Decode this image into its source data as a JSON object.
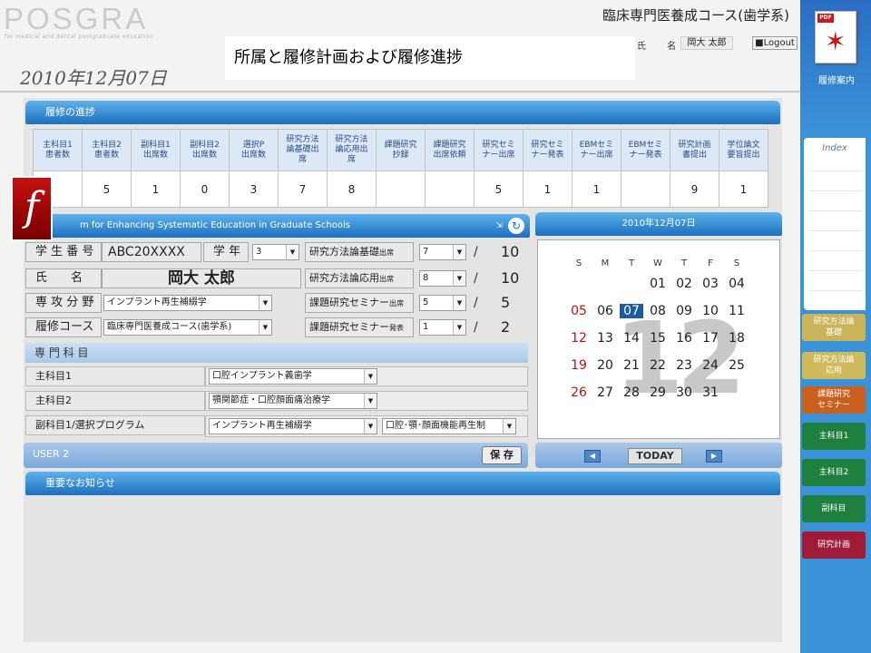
{
  "header": {
    "logo": "POSGRA",
    "logo_sub": "for medical and dental postgraduate education",
    "course": "臨床専門医養成コース(歯学系)",
    "name_label": "氏 名",
    "name_value": "岡大 太郎",
    "logout_label": "■Logout",
    "date": "2010年12月07日"
  },
  "popup": {
    "title": "所属と履修計画および履修進捗"
  },
  "progress": {
    "title": "履修の進捗",
    "headers": [
      "主科目1患者数",
      "主科目2患者数",
      "副科目1出席数",
      "副科目2出席数",
      "選択P出席数",
      "研究方法論基礎出席",
      "研究方法論応用出席",
      "課題研究抄録",
      "課題研究出席依頼",
      "研究セミナー出席",
      "研究セミナー発表",
      "EBMセミナー出席",
      "EBMセミナー発表",
      "研究計画書提出",
      "学位論文要旨提出"
    ],
    "headers_html": [
      "主科目1<br>患者数",
      "主科目2<br>患者数",
      "副科目1<br>出席数",
      "副科目2<br>出席数",
      "選択P<br>出席数",
      "研究方法<br>論基礎出<br>席",
      "研究方法<br>論応用出<br>席",
      "課題研究<br>抄録",
      "課題研究<br>出席依頼",
      "研究セミ<br>ナー出席",
      "研究セミ<br>ナー発表",
      "EBMセミ<br>ナー出席",
      "EBMセミ<br>ナー発表",
      "研究計画<br>書提出",
      "学位論文<br>要旨提出"
    ],
    "values": [
      "",
      "5",
      "1",
      "0",
      "3",
      "7",
      "8",
      "",
      "",
      "5",
      "1",
      "1",
      "",
      "9",
      "1"
    ]
  },
  "form": {
    "bar_title": "m for Enhancing Systematic Education in Graduate Schools",
    "student_no_label": "学 生 番 号",
    "student_no": "ABC20XXXX",
    "year_label": "学 年",
    "year_value": "3",
    "name_label": "氏　　名",
    "name_value": "岡大 太郎",
    "major_label": "専 攻 分 野",
    "major_value": "インプラント再生補綴学",
    "course_label": "履修コース",
    "course_value": "臨床専門医養成コース(歯学系)",
    "rows": [
      {
        "label": "研究方法論基礎",
        "suffix": "出席",
        "value": "7",
        "goal": "10"
      },
      {
        "label": "研究方法論応用",
        "suffix": "出席",
        "value": "8",
        "goal": "10"
      },
      {
        "label": "課題研究セミナー",
        "suffix": "出席",
        "value": "5",
        "goal": "5"
      },
      {
        "label": "課題研究セミナー",
        "suffix": "発表",
        "value": "1",
        "goal": "2"
      }
    ],
    "slash": "/",
    "section_title": "専 門 科 目",
    "main1_label": "主科目1",
    "main1_value": "口腔インプラント義歯学",
    "main2_label": "主科目2",
    "main2_value": "顎関節症・口腔顔面痛治療学",
    "sub_label": "副科目1/選択プログラム",
    "sub_value": "インプラント再生補綴学",
    "sub_value2": "口腔･顎･顔面機能再生制",
    "user_label": "USER 2",
    "save_label": "保 存"
  },
  "calendar": {
    "title": "2010年12月07日",
    "big": "12",
    "weekdays": [
      "S",
      "M",
      "T",
      "W",
      "T",
      "F",
      "S"
    ],
    "today": "7",
    "today_label": "TODAY",
    "prev_icon": "◀",
    "next_icon": "▶"
  },
  "notice": {
    "title": "重要なお知らせ"
  },
  "sidebar": {
    "pdf_tag": "PDF",
    "pdf_label": "履修案内",
    "index_title": "Index",
    "buttons": [
      {
        "label": "研究方法論<br>基礎",
        "color": "#c9b45a"
      },
      {
        "label": "研究方法論<br>応用",
        "color": "#cfba5c"
      },
      {
        "label": "課題研究<br>セミナー",
        "color": "#c8601f"
      },
      {
        "label": "主科目1",
        "color": "#1e7f3e"
      },
      {
        "label": "主科目2",
        "color": "#1e7f3e"
      },
      {
        "label": "副科目",
        "color": "#1e7f3e"
      },
      {
        "label": "研究計画",
        "color": "#a01a3a"
      }
    ]
  }
}
